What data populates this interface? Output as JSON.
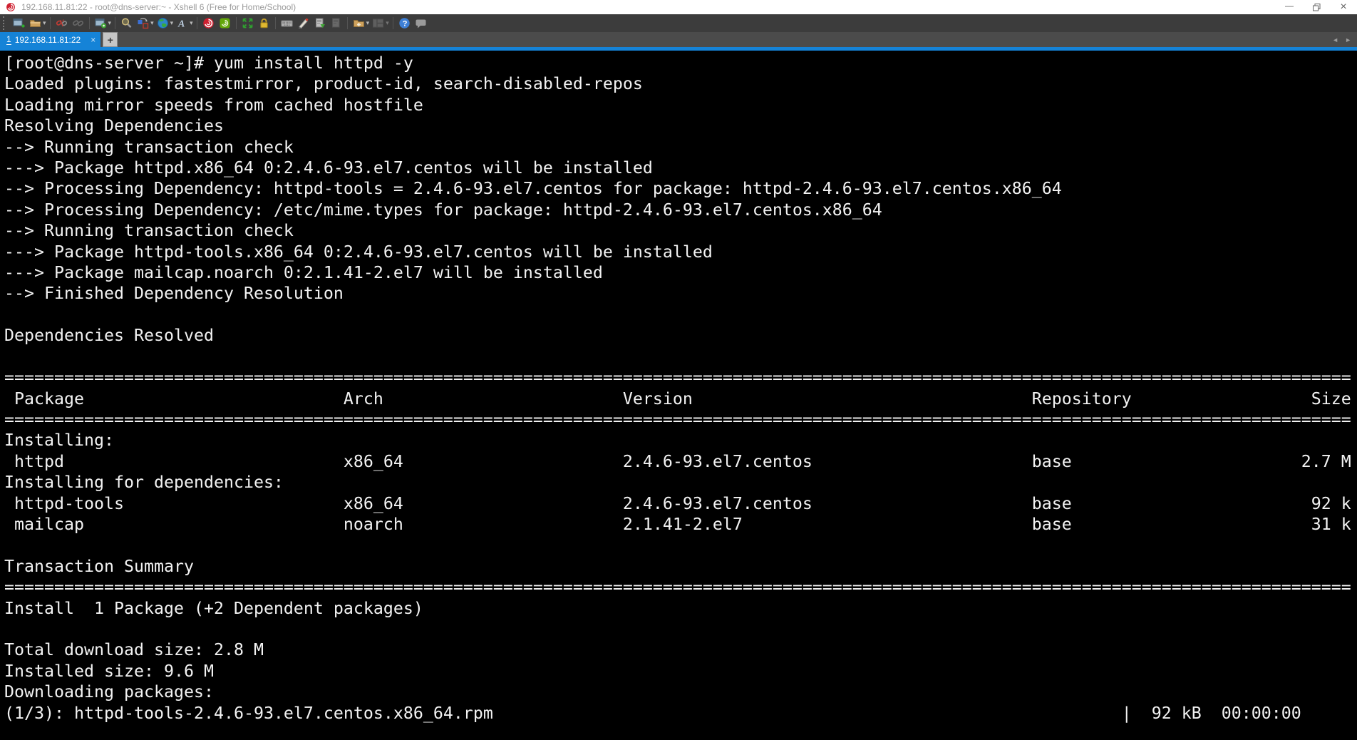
{
  "window": {
    "title": "192.168.11.81:22 - root@dns-server:~ - Xshell 6 (Free for Home/School)",
    "controls": {
      "minimize": "—",
      "close": "×"
    }
  },
  "toolbar": {
    "icons": [
      "new-session",
      "open-session",
      "disconnect",
      "reconnect",
      "session-properties",
      "find",
      "compose",
      "encoding",
      "font",
      "xshell",
      "xftp",
      "fullscreen",
      "lock-screen",
      "virtual-keyboard",
      "highlight",
      "logging-start",
      "logging-stop",
      "new-folder",
      "layout",
      "help",
      "feedback"
    ]
  },
  "tabbar": {
    "tab_index": "1",
    "tab_label": "192.168.11.81:22",
    "close_glyph": "×",
    "new_tab_glyph": "+",
    "scroll_left_glyph": "◄",
    "scroll_right_glyph": "►"
  },
  "colors": {
    "titlebar_bg": "#ffffff",
    "titlebar_text": "#9b9b9b",
    "toolbar_bg": "#3c3c3c",
    "tabbar_bg": "#4b4b4b",
    "active_tab_bg": "#1583d7",
    "xshell_logo_red": "#cf2030",
    "terminal_bg": "#000000",
    "terminal_text": "#f2f2f2"
  },
  "terminal": {
    "prompt": "[root@dns-server ~]#",
    "command": "yum install httpd -y",
    "table": {
      "headers": [
        "Package",
        "Arch",
        "Version",
        "Repository",
        "Size"
      ],
      "rows": [
        {
          "section": "Installing:",
          "package": "httpd",
          "arch": "x86_64",
          "version": "2.4.6-93.el7.centos",
          "repository": "base",
          "size": "2.7 M"
        },
        {
          "section": "Installing for dependencies:",
          "package": "httpd-tools",
          "arch": "x86_64",
          "version": "2.4.6-93.el7.centos",
          "repository": "base",
          "size": "92 k"
        },
        {
          "section": "Installing for dependencies:",
          "package": "mailcap",
          "arch": "noarch",
          "version": "2.1.41-2.el7",
          "repository": "base",
          "size": "31 k"
        }
      ]
    },
    "summary": {
      "install": "Install  1 Package (+2 Dependent packages)",
      "total_download_size": "2.8 M",
      "installed_size": "9.6 M",
      "download_progress": "(1/3): httpd-tools-2.4.6-93.el7.centos.x86_64.rpm  |  92 kB  00:00:00"
    },
    "lines": [
      "[root@dns-server ~]# yum install httpd -y",
      "Loaded plugins: fastestmirror, product-id, search-disabled-repos",
      "Loading mirror speeds from cached hostfile",
      "Resolving Dependencies",
      "--> Running transaction check",
      "---> Package httpd.x86_64 0:2.4.6-93.el7.centos will be installed",
      "--> Processing Dependency: httpd-tools = 2.4.6-93.el7.centos for package: httpd-2.4.6-93.el7.centos.x86_64",
      "--> Processing Dependency: /etc/mime.types for package: httpd-2.4.6-93.el7.centos.x86_64",
      "--> Running transaction check",
      "---> Package httpd-tools.x86_64 0:2.4.6-93.el7.centos will be installed",
      "---> Package mailcap.noarch 0:2.1.41-2.el7 will be installed",
      "--> Finished Dependency Resolution",
      "",
      "Dependencies Resolved",
      "",
      "=======================================================================================================================================",
      " Package                          Arch                        Version                                  Repository                  Size",
      "=======================================================================================================================================",
      "Installing:",
      " httpd                            x86_64                      2.4.6-93.el7.centos                      base                       2.7 M",
      "Installing for dependencies:",
      " httpd-tools                      x86_64                      2.4.6-93.el7.centos                      base                        92 k",
      " mailcap                          noarch                      2.1.41-2.el7                             base                        31 k",
      "",
      "Transaction Summary",
      "=======================================================================================================================================",
      "Install  1 Package (+2 Dependent packages)",
      "",
      "Total download size: 2.8 M",
      "Installed size: 9.6 M",
      "Downloading packages:",
      "(1/3): httpd-tools-2.4.6-93.el7.centos.x86_64.rpm                                                               |  92 kB  00:00:00"
    ]
  }
}
